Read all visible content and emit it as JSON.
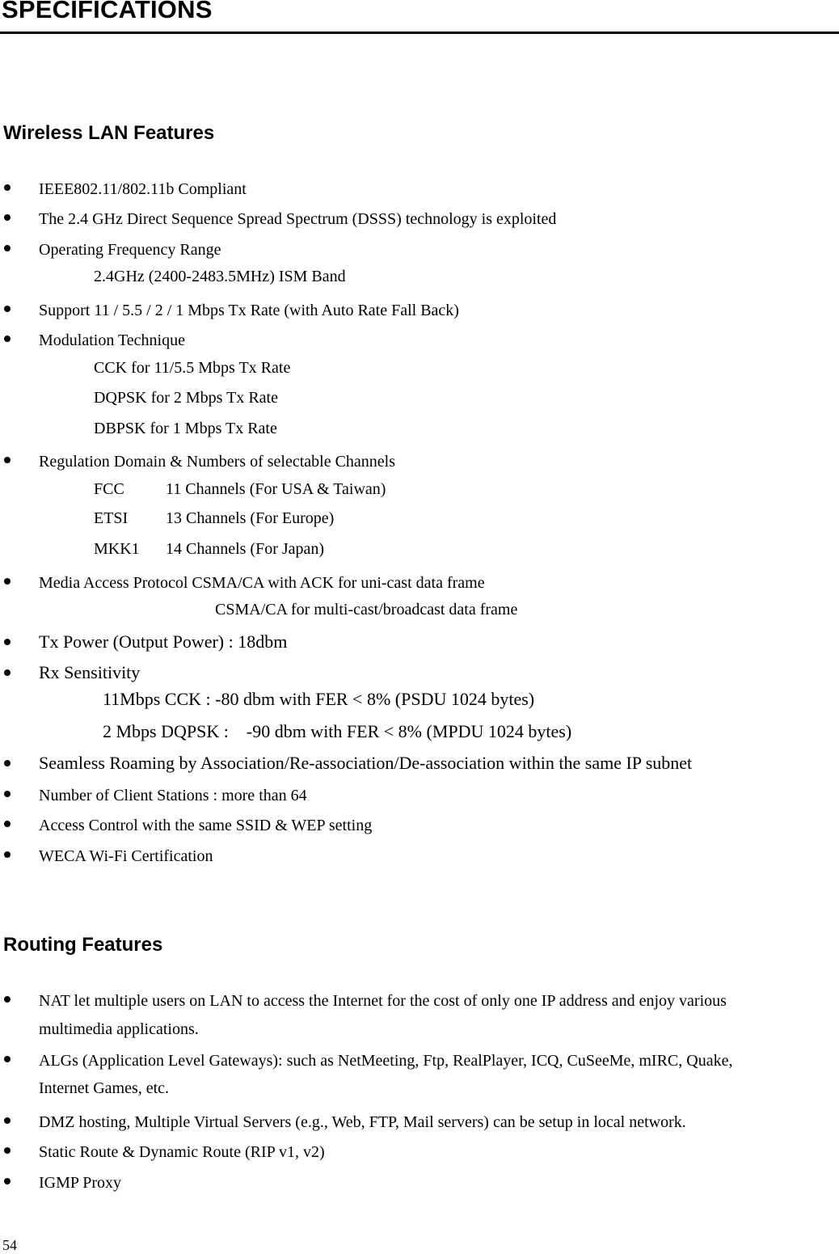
{
  "page": {
    "title": "SPECIFICATIONS",
    "page_number": "54"
  },
  "wireless": {
    "heading": "Wireless LAN Features",
    "items": [
      "IEEE802.11/802.11b Compliant",
      "The 2.4 GHz Direct Sequence Spread Spectrum (DSSS) technology is exploited",
      "Operating Frequency Range",
      "Support 11 / 5.5 / 2 / 1 Mbps Tx Rate (with Auto Rate Fall Back)",
      "Modulation Technique",
      "Regulation Domain & Numbers of selectable Channels",
      "Media Access Protocol CSMA/CA with ACK for uni-cast data frame",
      "Tx Power (Output Power) : 18dbm",
      "Rx Sensitivity",
      "Seamless Roaming by Association/Re-association/De-association within the same IP subnet",
      "Number of Client Stations : more than 64",
      "Access Control with the same SSID & WEP setting",
      "WECA Wi-Fi Certification"
    ],
    "frequency_band": "2.4GHz (2400-2483.5MHz) ISM Band",
    "modulation": [
      "CCK for 11/5.5 Mbps Tx Rate",
      "DQPSK for 2 Mbps Tx Rate",
      "DBPSK for 1 Mbps Tx Rate"
    ],
    "channels": [
      {
        "domain": "FCC",
        "desc": "11 Channels (For USA & Taiwan)"
      },
      {
        "domain": "ETSI",
        "desc": "13 Channels (For Europe)"
      },
      {
        "domain": "MKK1",
        "desc": "14 Channels (For Japan)"
      }
    ],
    "mac_multicast": "CSMA/CA for multi-cast/broadcast data frame",
    "rx_sensitivity": [
      "11Mbps CCK : -80 dbm with FER < 8% (PSDU 1024 bytes)",
      "2 Mbps DQPSK :    -90 dbm with FER < 8% (MPDU 1024 bytes)"
    ]
  },
  "routing": {
    "heading": "Routing Features",
    "items": [
      {
        "line1": "NAT let multiple users on LAN to access the Internet for the cost of only one IP address and enjoy various",
        "line2": "multimedia applications."
      },
      {
        "line1": "ALGs (Application Level Gateways): such as NetMeeting, Ftp, RealPlayer, ICQ, CuSeeMe, mIRC, Quake,",
        "line2": "Internet Games, etc."
      },
      {
        "line1": "DMZ hosting, Multiple Virtual Servers (e.g., Web, FTP, Mail servers) can be setup in local network."
      },
      {
        "line1": "Static Route & Dynamic Route (RIP v1, v2)"
      },
      {
        "line1": "IGMP Proxy"
      }
    ]
  }
}
